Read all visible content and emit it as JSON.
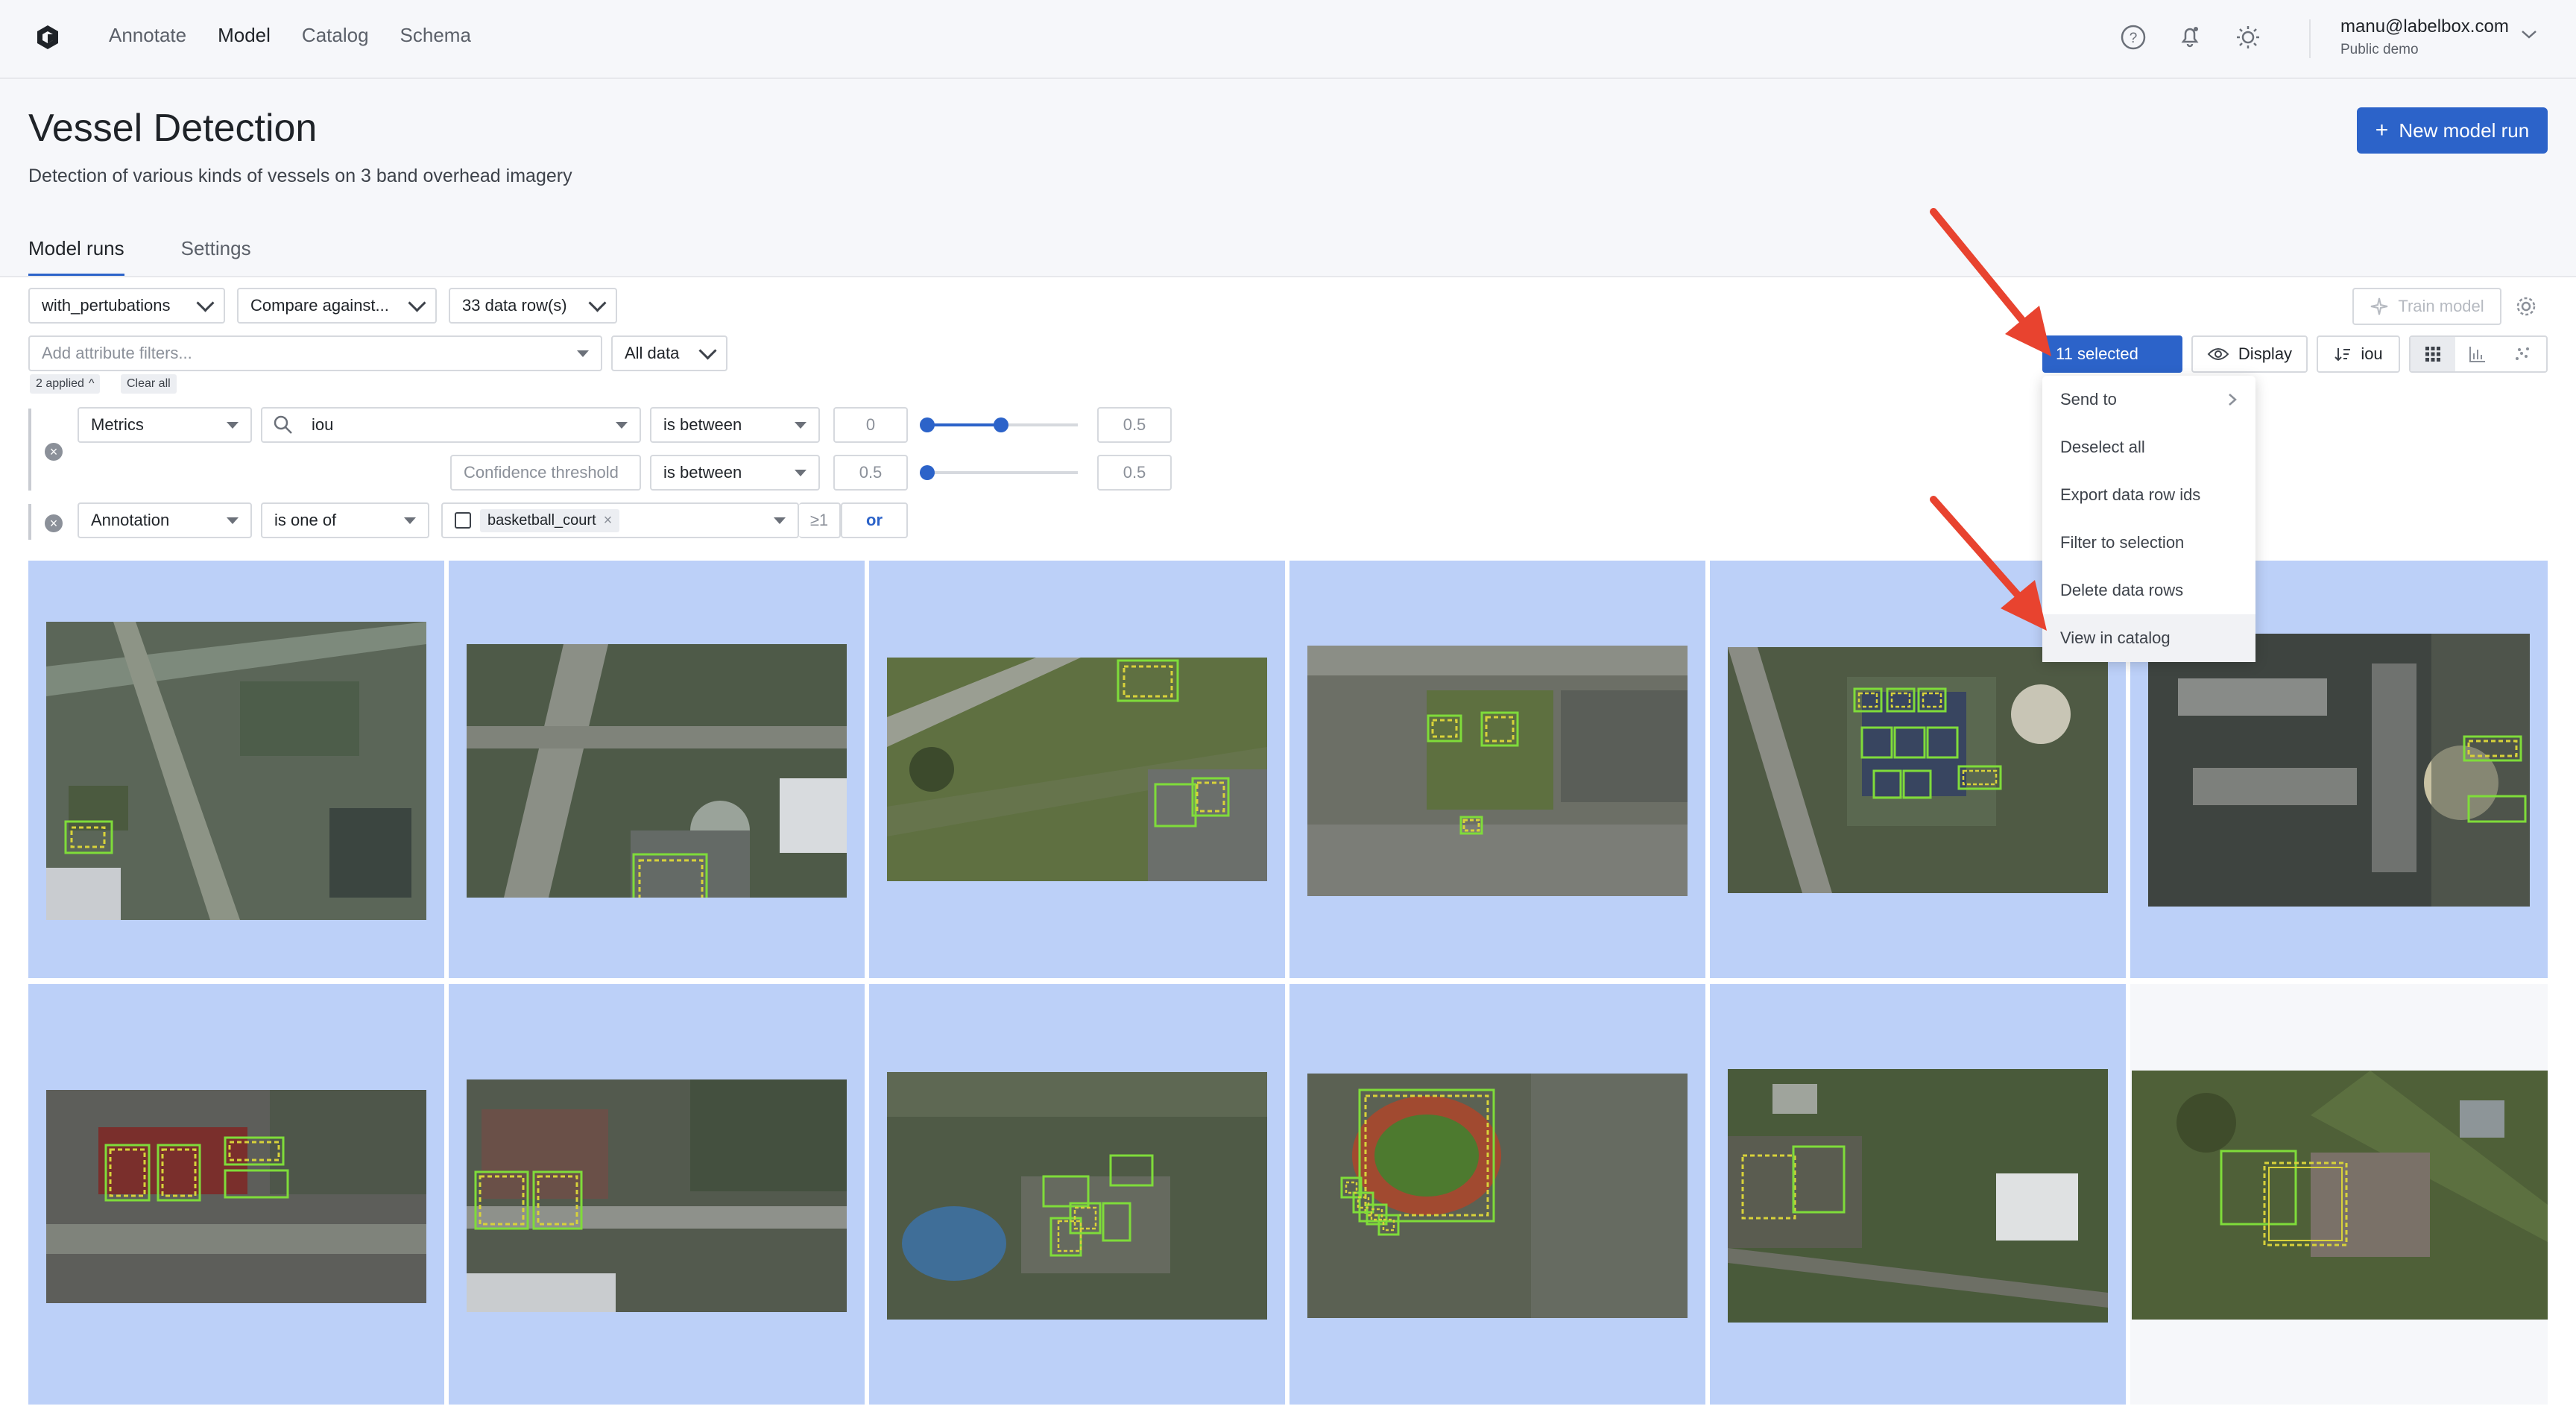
{
  "nav": {
    "items": [
      "Annotate",
      "Model",
      "Catalog",
      "Schema"
    ],
    "active": "Model"
  },
  "user": {
    "email": "manu@labelbox.com",
    "org": "Public demo"
  },
  "page": {
    "title": "Vessel Detection",
    "description": "Detection of various kinds of vessels on 3 band overhead imagery",
    "new_run_label": "New model run"
  },
  "tabs": [
    "Model runs",
    "Settings"
  ],
  "toolbar": {
    "run": "with_pertubations",
    "compare": "Compare against...",
    "rows": "33 data row(s)",
    "attr_placeholder": "Add attribute filters...",
    "all_data": "All data",
    "applied": "2 applied",
    "clear_all": "Clear all",
    "train_model": "Train model",
    "selected": "11 selected",
    "display": "Display",
    "sort": "iou"
  },
  "filters": {
    "row1": {
      "type": "Metrics",
      "metric": "iou",
      "op": "is between",
      "min": "0",
      "max": "0.5",
      "level": 0.5
    },
    "row2": {
      "field_placeholder": "Confidence threshold",
      "op": "is between",
      "min": "0.5",
      "max": "0.5"
    },
    "row3": {
      "type": "Annotation",
      "op": "is one of",
      "value": "basketball_court",
      "count": "≥1",
      "or": "or"
    }
  },
  "menu": {
    "items": [
      "Send to",
      "Deselect all",
      "Export data row ids",
      "Filter to selection",
      "Delete data rows",
      "View in catalog"
    ],
    "highlighted": "View in catalog"
  },
  "colors": {
    "accent": "#2c63c9",
    "selected_cell": "#bcd0f8",
    "arrow": "#e8432f",
    "box_green": "#7fdc3a",
    "box_yellow": "#d8d23a"
  },
  "grid": {
    "rows": 2,
    "cols": 6,
    "selected_count": 11
  }
}
